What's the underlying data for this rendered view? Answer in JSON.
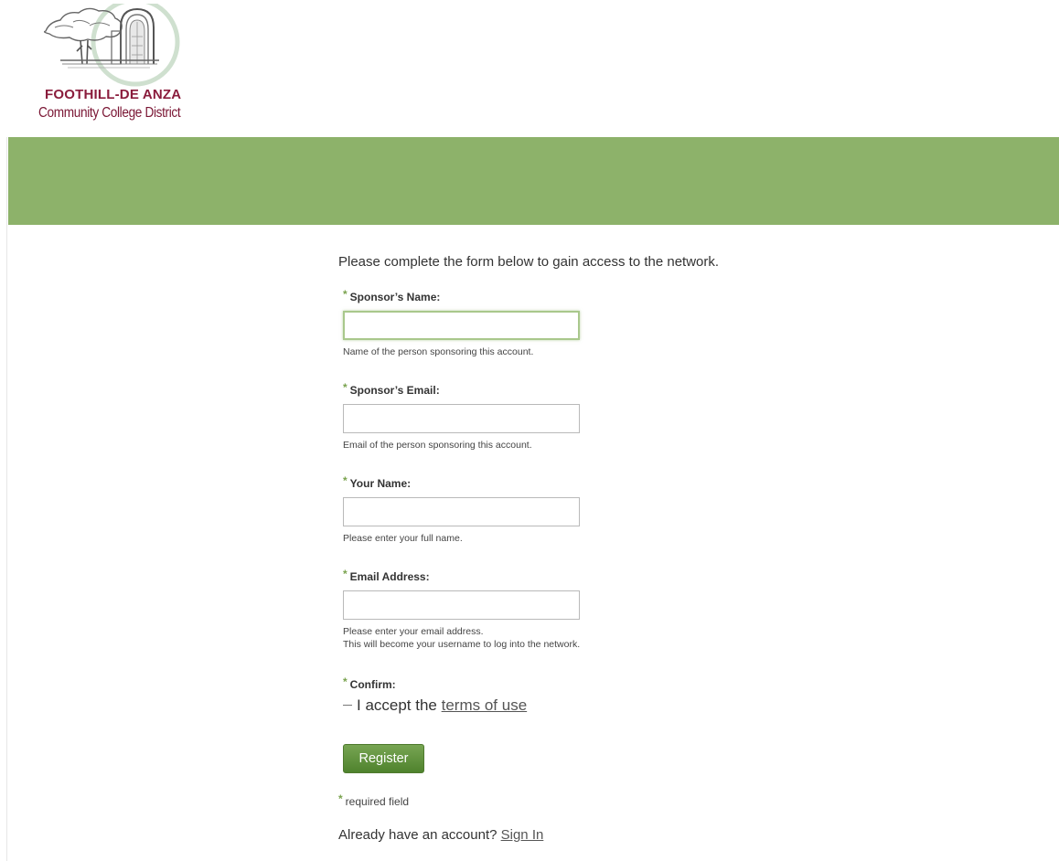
{
  "logo": {
    "line1": "FOOTHILL-DE ANZA",
    "line2": "Community College District",
    "icon": "campus-arch-tree-logo"
  },
  "colors": {
    "banner": "#8db26a",
    "brand_maroon": "#8a1c3c",
    "required_marker": "#7aa34f",
    "button": "#5f9338"
  },
  "form": {
    "intro": "Please complete the form below to gain access to the network.",
    "required_marker": "*",
    "fields": [
      {
        "label": "Sponsor’s Name:",
        "value": "",
        "hint": "Name of the person sponsoring this account."
      },
      {
        "label": "Sponsor’s Email:",
        "value": "",
        "hint": "Email of the person sponsoring this account."
      },
      {
        "label": "Your Name:",
        "value": "",
        "hint": "Please enter your full name."
      },
      {
        "label": "Email Address:",
        "value": "",
        "hint_line1": "Please enter your email address.",
        "hint_line2": "This will become your username to log into the network."
      }
    ],
    "confirm": {
      "label": "Confirm:",
      "text": "I accept the",
      "link": "terms of use",
      "checked": false
    },
    "register_label": "Register",
    "required_note": "required field",
    "signin_prompt": "Already have an account?",
    "signin_link": "Sign In"
  }
}
